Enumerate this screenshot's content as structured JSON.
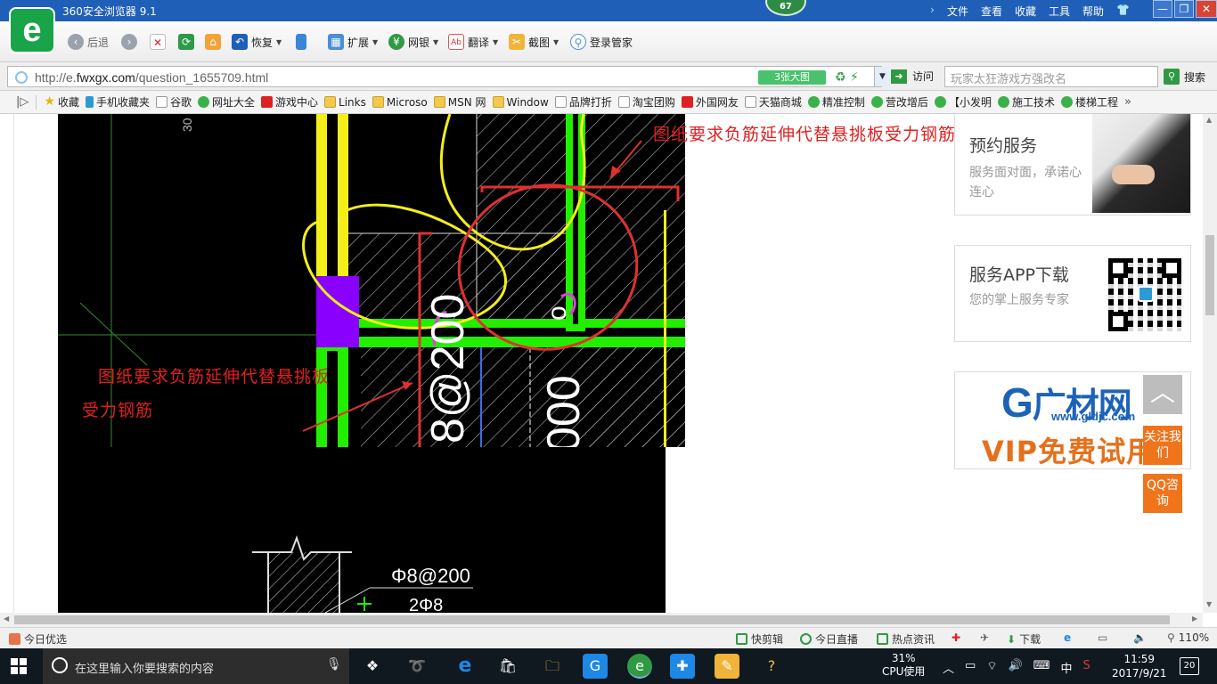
{
  "window": {
    "title": "360安全浏览器 9.1",
    "badge": "67",
    "menu": [
      "文件",
      "查看",
      "收藏",
      "工具",
      "帮助"
    ],
    "controls": [
      "—",
      "❐",
      "✕"
    ]
  },
  "toolbar": {
    "back": "后退",
    "restore": "恢复",
    "extend": "扩展",
    "netbank": "网银",
    "translate": "翻译",
    "screenshot": "截图",
    "login": "登录管家"
  },
  "address": {
    "url_prefix": "http://e.",
    "url_domain": "fwxgx.com",
    "url_path": "/question_1655709.html",
    "images_btn": "3张大图",
    "visit": "访问",
    "search_placeholder": "玩家太狂游戏方强改名",
    "search_btn": "搜索"
  },
  "bookmarks": [
    {
      "label": "收藏",
      "icon": "star"
    },
    {
      "label": "手机收藏夹",
      "icon": "phone"
    },
    {
      "label": "谷歌",
      "icon": "page"
    },
    {
      "label": "网址大全",
      "icon": "green"
    },
    {
      "label": "游戏中心",
      "icon": "red"
    },
    {
      "label": "Links",
      "icon": "folder"
    },
    {
      "label": "Microso",
      "icon": "folder"
    },
    {
      "label": "MSN 网",
      "icon": "folder"
    },
    {
      "label": "Window",
      "icon": "folder"
    },
    {
      "label": "品牌打折",
      "icon": "page"
    },
    {
      "label": "淘宝团购",
      "icon": "page"
    },
    {
      "label": "外国网友",
      "icon": "red"
    },
    {
      "label": "天猫商城",
      "icon": "page"
    },
    {
      "label": "精准控制",
      "icon": "green"
    },
    {
      "label": "营改增后",
      "icon": "green"
    },
    {
      "label": "【小发明",
      "icon": "green"
    },
    {
      "label": "施工技术",
      "icon": "green"
    },
    {
      "label": "楼梯工程",
      "icon": "green"
    }
  ],
  "content": {
    "annotation_top": "图纸要求负筋延伸代替悬挑板受力钢筋",
    "annotation_left_line1": "图纸要求负筋延伸代替悬挑板",
    "annotation_left_line2": "受力钢筋",
    "cad_text_rebar": "8@200",
    "cad_text_dim": "000",
    "cad_text_corner": "30",
    "cad_text_phi": "Φ8@200",
    "cad_text_bottom": "2Φ8"
  },
  "sidebar": {
    "card1": {
      "title": "预约服务",
      "desc": "服务面对面，承诺心连心"
    },
    "card2": {
      "title": "服务APP下载",
      "desc": "您的掌上服务专家"
    },
    "card3": {
      "logo": "广材网",
      "url": "www.gldjc.com",
      "vip": "VIP免费试用"
    },
    "float_up": "︿",
    "follow": "关注我们",
    "qq": "QQ咨询"
  },
  "statusbar": {
    "left": "今日优选",
    "kuaijian": "快剪辑",
    "live": "今日直播",
    "news": "热点资讯",
    "download": "下载",
    "zoom": "110%"
  },
  "taskbar": {
    "search_placeholder": "在这里输入你要搜索的内容",
    "cpu_percent": "31%",
    "cpu_label": "CPU使用",
    "ime": "中",
    "time": "11:59",
    "date": "2017/9/21",
    "notifications": "20"
  },
  "colors": {
    "titlebar": "#1f5fb8",
    "annotation": "#e02020",
    "cad_green": "#22ee00",
    "cad_yellow": "#f4ee1a",
    "cad_purple": "#8a00ff",
    "accent_orange": "#f0741c"
  }
}
